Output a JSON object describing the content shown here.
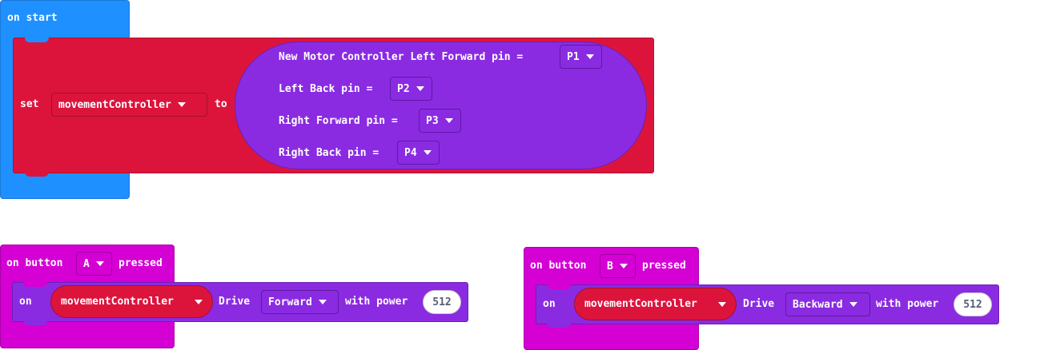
{
  "on_start": {
    "label": "on start",
    "set_block": {
      "set_label": "set",
      "variable": "movementController",
      "to_label": "to",
      "constructor": {
        "title": "New Motor Controller Left Forward pin =",
        "left_forward_pin": "P1",
        "left_back_label": "Left Back pin =",
        "left_back_pin": "P2",
        "right_forward_label": "Right Forward pin =",
        "right_forward_pin": "P3",
        "right_back_label": "Right Back pin =",
        "right_back_pin": "P4"
      }
    }
  },
  "button_a": {
    "on_label": "on button",
    "button": "A",
    "pressed_label": "pressed",
    "call": {
      "on_label": "on",
      "controller": "movementController",
      "drive_label": "Drive",
      "direction": "Forward",
      "power_label": "with power",
      "power": "512"
    }
  },
  "button_b": {
    "on_label": "on button",
    "button": "B",
    "pressed_label": "pressed",
    "call": {
      "on_label": "on",
      "controller": "movementController",
      "drive_label": "Drive",
      "direction": "Backward",
      "power_label": "with power",
      "power": "512"
    }
  },
  "colors": {
    "basic": "#1e90ff",
    "input": "#d400d4",
    "variables": "#dc143c",
    "extension": "#8a2be2",
    "workspace": "#ffffff"
  }
}
